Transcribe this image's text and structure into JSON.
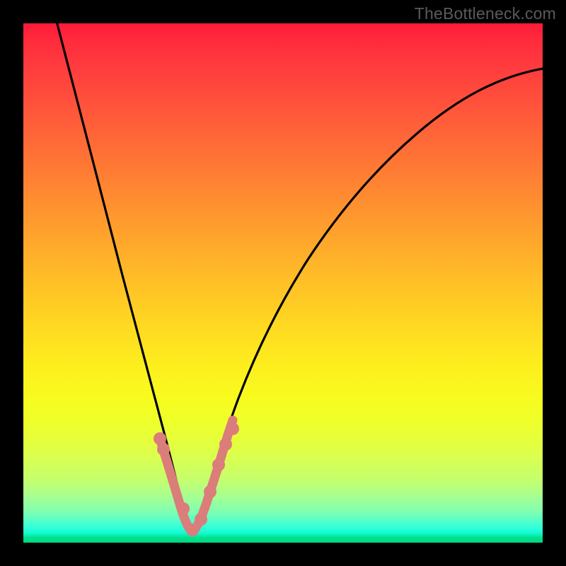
{
  "watermark": "TheBottleneck.com",
  "chart_data": {
    "type": "line",
    "title": "",
    "xlabel": "",
    "ylabel": "",
    "xlim": [
      0,
      100
    ],
    "ylim": [
      0,
      100
    ],
    "grid": false,
    "legend": false,
    "note": "Values estimated from pixel positions; x is horizontal percentage of plot area, y is percentage from bottom (0) to top (100).",
    "series": [
      {
        "name": "bottleneck-curve",
        "color": "#000000",
        "x": [
          6.5,
          8.5,
          10.5,
          12.5,
          14.5,
          16.5,
          18.5,
          20.5,
          22.5,
          24.0,
          25.5,
          27.0,
          28.5,
          30.0,
          31.0,
          31.8,
          32.5,
          33.3,
          34.5,
          36.0,
          38.0,
          40.0,
          41.5,
          43.5,
          46.0,
          49.0,
          53.0,
          57.0,
          62.0,
          68.0,
          74.0,
          80.0,
          86.0,
          92.0,
          98.0,
          100.0
        ],
        "y": [
          100.0,
          92.0,
          83.5,
          75.0,
          67.0,
          59.0,
          51.0,
          43.0,
          35.0,
          29.0,
          23.5,
          18.0,
          13.0,
          8.5,
          5.0,
          3.0,
          2.3,
          3.0,
          5.0,
          9.0,
          15.0,
          21.0,
          25.5,
          31.0,
          37.5,
          44.5,
          53.0,
          60.0,
          67.5,
          74.5,
          79.5,
          83.5,
          86.5,
          89.0,
          90.8,
          91.3
        ]
      },
      {
        "name": "highlight-segment",
        "color": "#db7d7a",
        "x": [
          26.3,
          27.5,
          29.0,
          30.0,
          31.0,
          31.8,
          32.6,
          33.4,
          34.4,
          35.6,
          36.8,
          38.0,
          39.2,
          40.3
        ],
        "y": [
          20.0,
          16.5,
          11.5,
          8.0,
          5.0,
          3.0,
          2.4,
          3.0,
          5.0,
          8.5,
          12.0,
          16.0,
          19.5,
          22.0
        ]
      },
      {
        "name": "highlight-dots",
        "color": "#db7d7a",
        "type": "scatter",
        "x": [
          26.3,
          27.0,
          30.8,
          32.5,
          34.2,
          36.0,
          37.6,
          39.0,
          40.3
        ],
        "y": [
          20.0,
          18.0,
          6.5,
          2.5,
          4.5,
          9.8,
          15.0,
          19.0,
          22.0
        ]
      }
    ]
  }
}
